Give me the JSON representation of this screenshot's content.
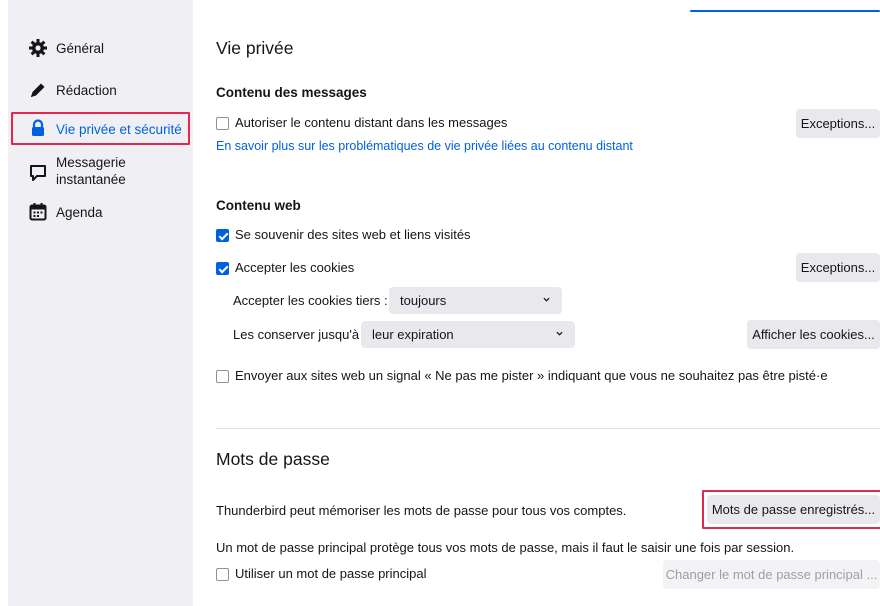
{
  "sidebar": {
    "items": [
      {
        "label": "Général",
        "icon": "gear-icon"
      },
      {
        "label": "Rédaction",
        "icon": "pen-icon"
      },
      {
        "label": "Vie privée et sécurité",
        "icon": "lock-icon"
      },
      {
        "label": "Messagerie\ninstantanée",
        "icon": "chat-icon"
      },
      {
        "label": "Agenda",
        "icon": "calendar-icon"
      }
    ],
    "active_index": 2
  },
  "privacy": {
    "title": "Vie privée",
    "messages_heading": "Contenu des messages",
    "remote_content_label": "Autoriser le contenu distant dans les messages",
    "remote_content_checked": false,
    "exceptions_label": "Exceptions...",
    "learn_more_link": "En savoir plus sur les problématiques de vie privée liées au contenu distant",
    "web_heading": "Contenu web",
    "remember_sites_label": "Se souvenir des sites web et liens visités",
    "remember_sites_checked": true,
    "accept_cookies_label": "Accepter les cookies",
    "accept_cookies_checked": true,
    "cookies_exceptions_label": "Exceptions...",
    "third_party_label": "Accepter les cookies tiers :",
    "third_party_value": "toujours",
    "keep_until_label": "Les conserver jusqu'à :",
    "keep_until_value": "leur expiration",
    "show_cookies_label": "Afficher les cookies...",
    "dnt_label": "Envoyer aux sites web un signal « Ne pas me pister » indiquant que vous ne souhaitez pas être pisté·e",
    "dnt_checked": false
  },
  "passwords": {
    "title": "Mots de passe",
    "remember_text": "Thunderbird peut mémoriser les mots de passe pour tous vos comptes.",
    "saved_button": "Mots de passe enregistrés...",
    "primary_info": "Un mot de passe principal protège tous vos mots de passe, mais il faut le saisir une fois par session.",
    "use_primary_label": "Utiliser un mot de passe principal",
    "use_primary_checked": false,
    "change_primary_button": "Changer le mot de passe principal ..."
  },
  "colors": {
    "accent": "#0061e0",
    "highlight": "#e22850",
    "sidebar_bg": "#f0f0f4"
  }
}
